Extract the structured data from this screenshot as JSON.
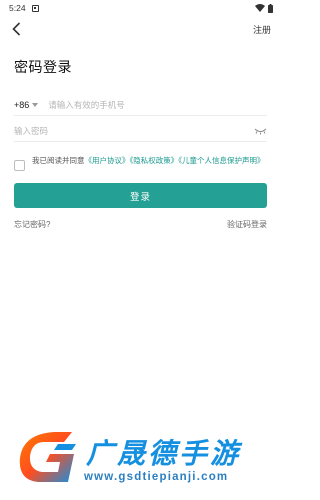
{
  "status_bar": {
    "time": "5:24",
    "icons": [
      "notification-icon",
      "wifi-icon",
      "battery-icon"
    ]
  },
  "header": {
    "back_icon": "chevron-left-icon",
    "register_label": "注册"
  },
  "title": "密码登录",
  "phone": {
    "country_code": "+86",
    "placeholder": "请输入有效的手机号"
  },
  "password": {
    "placeholder": "输入密码",
    "toggle_icon": "eye-closed-icon"
  },
  "agreement": {
    "prefix": "我已阅读并同意",
    "user_agreement": "《用户协议》",
    "privacy_policy": "《隐私权政策》",
    "children_policy": "《儿童个人信息保护声明》"
  },
  "login_button": "登录",
  "forgot_password": "忘记密码?",
  "sms_login": "验证码登录",
  "watermark": {
    "title": "广晟德手游",
    "url": "www.gsdtiepianji.com"
  },
  "colors": {
    "accent": "#25a095",
    "link": "#1a9a8f",
    "watermark_blue": "#1590e0"
  }
}
